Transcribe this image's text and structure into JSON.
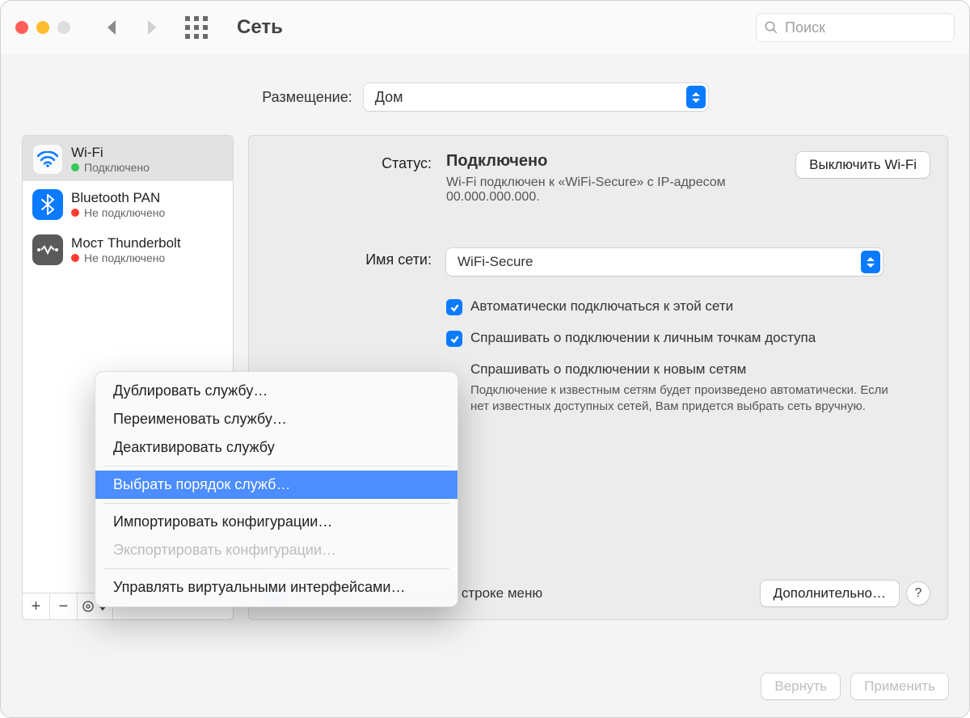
{
  "toolbar": {
    "title": "Сеть",
    "search_placeholder": "Поиск"
  },
  "location": {
    "label": "Размещение:",
    "value": "Дом"
  },
  "services": [
    {
      "name": "Wi-Fi",
      "status": "Подключено",
      "connected": true
    },
    {
      "name": "Bluetooth PAN",
      "status": "Не подключено",
      "connected": false
    },
    {
      "name": "Мост Thunderbolt",
      "status": "Не подключено",
      "connected": false
    }
  ],
  "main": {
    "status_label": "Статус:",
    "status_value": "Подключено",
    "status_info": "Wi-Fi подключен к «WiFi-Secure» с IP-адресом 00.000.000.000.",
    "wifi_off_btn": "Выключить Wi-Fi",
    "network_label": "Имя сети:",
    "network_value": "WiFi-Secure",
    "chk_auto_connect": "Автоматически подключаться к этой сети",
    "chk_ask_personal": "Спрашивать о подключении к личным точкам доступа",
    "chk_ask_new": "Спрашивать о подключении к новым сетям",
    "ask_new_help": "Подключение к известным сетям будет произведено автоматически. Если нет известных доступных сетей, Вам придется выбрать сеть вручную.",
    "chk_menubar": "Показывать статус Wi-Fi в строке меню",
    "advanced_btn": "Дополнительно…"
  },
  "context_menu": {
    "items": [
      "Дублировать службу…",
      "Переименовать службу…",
      "Деактивировать службу"
    ],
    "highlighted": "Выбрать порядок служб…",
    "import": "Импортировать конфигурации…",
    "export": "Экспортировать конфигурации…",
    "manage": "Управлять виртуальными интерфейсами…"
  },
  "footer": {
    "revert": "Вернуть",
    "apply": "Применить"
  }
}
